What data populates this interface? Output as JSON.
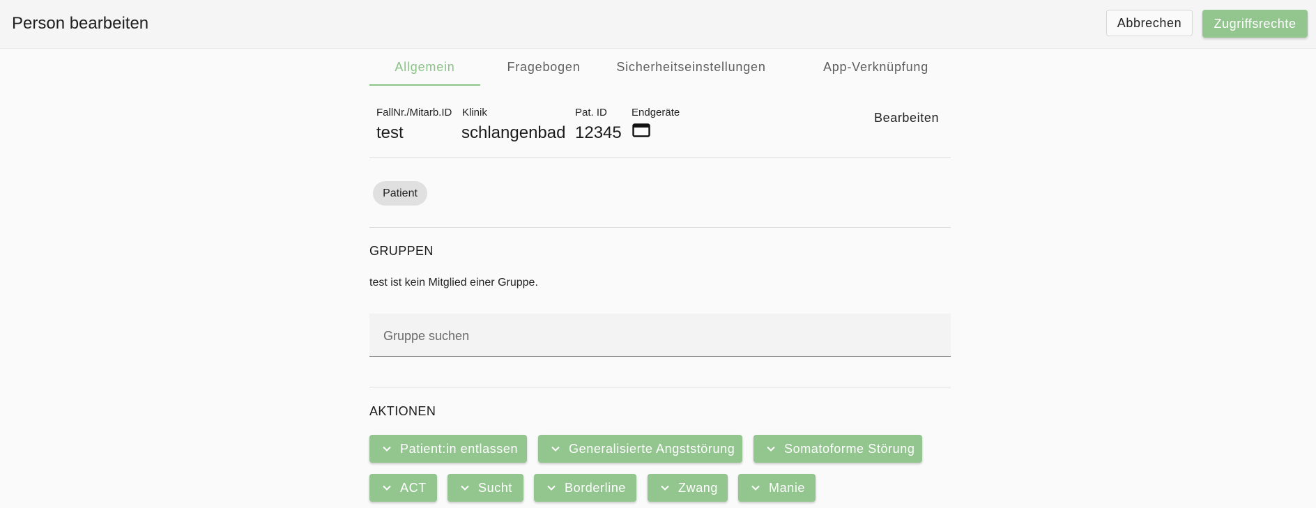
{
  "header": {
    "title": "Person bearbeiten",
    "cancel_label": "Abbrechen",
    "access_label": "Zugriffsrechte"
  },
  "tabs": [
    {
      "label": "Allgemein",
      "active": true
    },
    {
      "label": "Fragebogen",
      "active": false
    },
    {
      "label": "Sicherheitseinstellungen",
      "active": false
    },
    {
      "label": "App-Verknüpfung",
      "active": false
    }
  ],
  "info": {
    "fallnr_label": "FallNr./Mitarb.ID",
    "fallnr_value": "test",
    "klinik_label": "Klinik",
    "klinik_value": "schlangenbad",
    "patid_label": "Pat. ID",
    "patid_value": "12345",
    "devices_label": "Endgeräte",
    "devices_icon": "browser-window-icon",
    "edit_label": "Bearbeiten"
  },
  "role_chip": "Patient",
  "groups": {
    "title": "GRUPPEN",
    "message": "test ist kein Mitglied einer Gruppe.",
    "search_placeholder": "Gruppe suchen",
    "search_value": ""
  },
  "actions": {
    "title": "AKTIONEN",
    "items": [
      "Patient:in entlassen",
      "Generalisierte Angststörung",
      "Somatoforme Störung",
      "ACT",
      "Sucht",
      "Borderline",
      "Zwang",
      "Manie"
    ]
  },
  "colors": {
    "accent": "#93c58f",
    "tab_active": "#8cc388",
    "chip_bg": "#e0e0e0"
  }
}
